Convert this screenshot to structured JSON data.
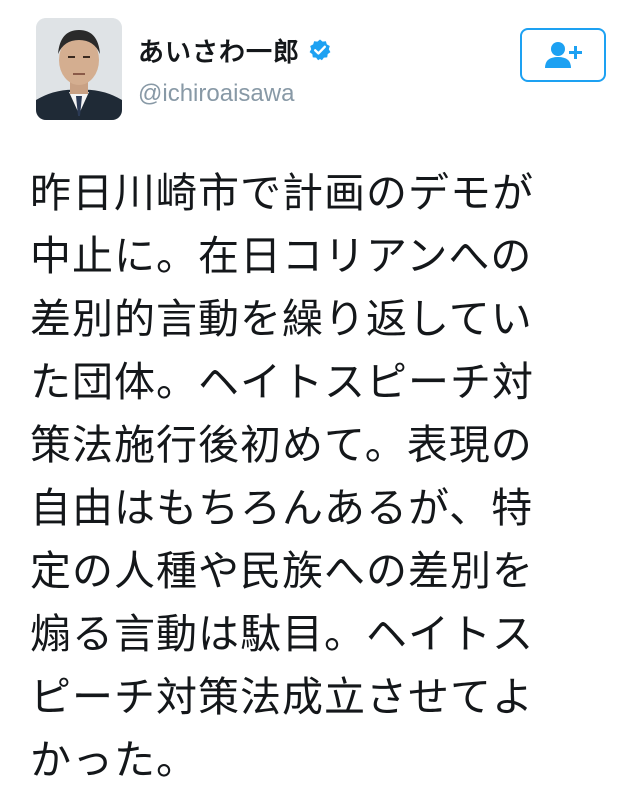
{
  "profile": {
    "display_name": "あいさわ一郎",
    "handle": "@ichiroaisawa",
    "verified": true,
    "avatar_icon": "user-photo"
  },
  "follow_button": {
    "icon": "add-user-icon"
  },
  "tweet": {
    "lines": [
      "昨日川崎市で計画のデモが",
      "中止に。在日コリアンへの",
      "差別的言動を繰り返してい",
      "た団体。ヘイトスピーチ対",
      "策法施行後初めて。表現の",
      "自由はもちろんあるが、特",
      "定の人種や民族への差別を",
      "煽る言動は駄目。ヘイトス",
      "ピーチ対策法成立させてよ",
      "かった。"
    ]
  },
  "colors": {
    "accent": "#1da1f2",
    "handle": "#8899a6",
    "text": "#14171a"
  }
}
